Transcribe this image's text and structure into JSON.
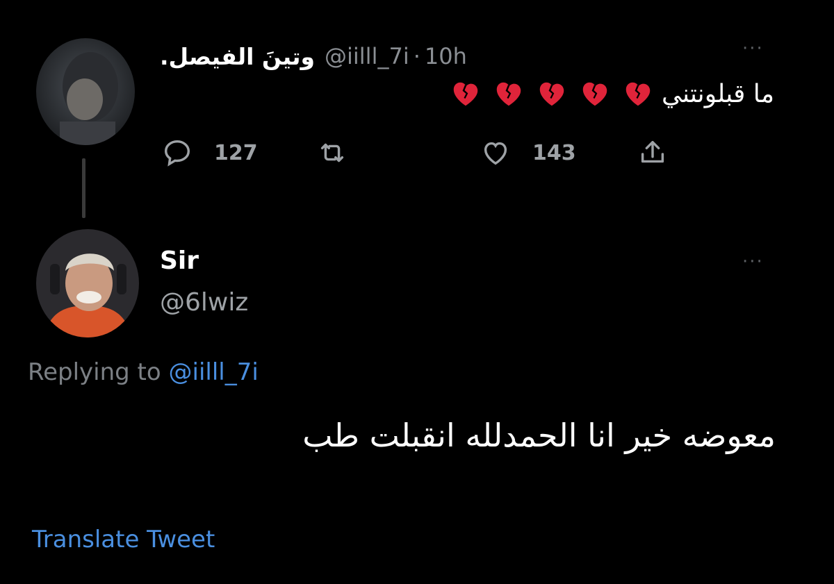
{
  "tweet1": {
    "display_name": "وتينَ الفيصل.",
    "handle": "@iilll_7i",
    "separator": "·",
    "time": "10h",
    "text": "ما قبلونتني",
    "emoji_count": 5,
    "emoji": "broken-heart",
    "more": "···",
    "actions": {
      "reply_count": "127",
      "retweet_count": "",
      "like_count": "143"
    }
  },
  "tweet2": {
    "display_name": "Sir",
    "handle": "@6lwiz",
    "more": "···",
    "replying_prefix": "Replying to",
    "replying_mention": "@iilll_7i",
    "text": "معوضه خير انا الحمدلله انقبلت طب",
    "translate_label": "Translate Tweet"
  },
  "colors": {
    "background": "#000000",
    "text": "#ffffff",
    "muted": "#9ea2a6",
    "link": "#4a8fe0",
    "heart_red": "#e0243a"
  }
}
